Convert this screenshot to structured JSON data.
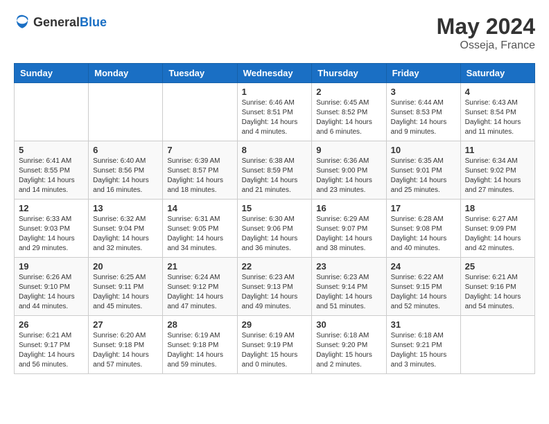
{
  "header": {
    "logo_general": "General",
    "logo_blue": "Blue",
    "month_year": "May 2024",
    "location": "Osseja, France"
  },
  "weekdays": [
    "Sunday",
    "Monday",
    "Tuesday",
    "Wednesday",
    "Thursday",
    "Friday",
    "Saturday"
  ],
  "weeks": [
    [
      {
        "day": "",
        "info": ""
      },
      {
        "day": "",
        "info": ""
      },
      {
        "day": "",
        "info": ""
      },
      {
        "day": "1",
        "info": "Sunrise: 6:46 AM\nSunset: 8:51 PM\nDaylight: 14 hours\nand 4 minutes."
      },
      {
        "day": "2",
        "info": "Sunrise: 6:45 AM\nSunset: 8:52 PM\nDaylight: 14 hours\nand 6 minutes."
      },
      {
        "day": "3",
        "info": "Sunrise: 6:44 AM\nSunset: 8:53 PM\nDaylight: 14 hours\nand 9 minutes."
      },
      {
        "day": "4",
        "info": "Sunrise: 6:43 AM\nSunset: 8:54 PM\nDaylight: 14 hours\nand 11 minutes."
      }
    ],
    [
      {
        "day": "5",
        "info": "Sunrise: 6:41 AM\nSunset: 8:55 PM\nDaylight: 14 hours\nand 14 minutes."
      },
      {
        "day": "6",
        "info": "Sunrise: 6:40 AM\nSunset: 8:56 PM\nDaylight: 14 hours\nand 16 minutes."
      },
      {
        "day": "7",
        "info": "Sunrise: 6:39 AM\nSunset: 8:57 PM\nDaylight: 14 hours\nand 18 minutes."
      },
      {
        "day": "8",
        "info": "Sunrise: 6:38 AM\nSunset: 8:59 PM\nDaylight: 14 hours\nand 21 minutes."
      },
      {
        "day": "9",
        "info": "Sunrise: 6:36 AM\nSunset: 9:00 PM\nDaylight: 14 hours\nand 23 minutes."
      },
      {
        "day": "10",
        "info": "Sunrise: 6:35 AM\nSunset: 9:01 PM\nDaylight: 14 hours\nand 25 minutes."
      },
      {
        "day": "11",
        "info": "Sunrise: 6:34 AM\nSunset: 9:02 PM\nDaylight: 14 hours\nand 27 minutes."
      }
    ],
    [
      {
        "day": "12",
        "info": "Sunrise: 6:33 AM\nSunset: 9:03 PM\nDaylight: 14 hours\nand 29 minutes."
      },
      {
        "day": "13",
        "info": "Sunrise: 6:32 AM\nSunset: 9:04 PM\nDaylight: 14 hours\nand 32 minutes."
      },
      {
        "day": "14",
        "info": "Sunrise: 6:31 AM\nSunset: 9:05 PM\nDaylight: 14 hours\nand 34 minutes."
      },
      {
        "day": "15",
        "info": "Sunrise: 6:30 AM\nSunset: 9:06 PM\nDaylight: 14 hours\nand 36 minutes."
      },
      {
        "day": "16",
        "info": "Sunrise: 6:29 AM\nSunset: 9:07 PM\nDaylight: 14 hours\nand 38 minutes."
      },
      {
        "day": "17",
        "info": "Sunrise: 6:28 AM\nSunset: 9:08 PM\nDaylight: 14 hours\nand 40 minutes."
      },
      {
        "day": "18",
        "info": "Sunrise: 6:27 AM\nSunset: 9:09 PM\nDaylight: 14 hours\nand 42 minutes."
      }
    ],
    [
      {
        "day": "19",
        "info": "Sunrise: 6:26 AM\nSunset: 9:10 PM\nDaylight: 14 hours\nand 44 minutes."
      },
      {
        "day": "20",
        "info": "Sunrise: 6:25 AM\nSunset: 9:11 PM\nDaylight: 14 hours\nand 45 minutes."
      },
      {
        "day": "21",
        "info": "Sunrise: 6:24 AM\nSunset: 9:12 PM\nDaylight: 14 hours\nand 47 minutes."
      },
      {
        "day": "22",
        "info": "Sunrise: 6:23 AM\nSunset: 9:13 PM\nDaylight: 14 hours\nand 49 minutes."
      },
      {
        "day": "23",
        "info": "Sunrise: 6:23 AM\nSunset: 9:14 PM\nDaylight: 14 hours\nand 51 minutes."
      },
      {
        "day": "24",
        "info": "Sunrise: 6:22 AM\nSunset: 9:15 PM\nDaylight: 14 hours\nand 52 minutes."
      },
      {
        "day": "25",
        "info": "Sunrise: 6:21 AM\nSunset: 9:16 PM\nDaylight: 14 hours\nand 54 minutes."
      }
    ],
    [
      {
        "day": "26",
        "info": "Sunrise: 6:21 AM\nSunset: 9:17 PM\nDaylight: 14 hours\nand 56 minutes."
      },
      {
        "day": "27",
        "info": "Sunrise: 6:20 AM\nSunset: 9:18 PM\nDaylight: 14 hours\nand 57 minutes."
      },
      {
        "day": "28",
        "info": "Sunrise: 6:19 AM\nSunset: 9:18 PM\nDaylight: 14 hours\nand 59 minutes."
      },
      {
        "day": "29",
        "info": "Sunrise: 6:19 AM\nSunset: 9:19 PM\nDaylight: 15 hours\nand 0 minutes."
      },
      {
        "day": "30",
        "info": "Sunrise: 6:18 AM\nSunset: 9:20 PM\nDaylight: 15 hours\nand 2 minutes."
      },
      {
        "day": "31",
        "info": "Sunrise: 6:18 AM\nSunset: 9:21 PM\nDaylight: 15 hours\nand 3 minutes."
      },
      {
        "day": "",
        "info": ""
      }
    ]
  ]
}
